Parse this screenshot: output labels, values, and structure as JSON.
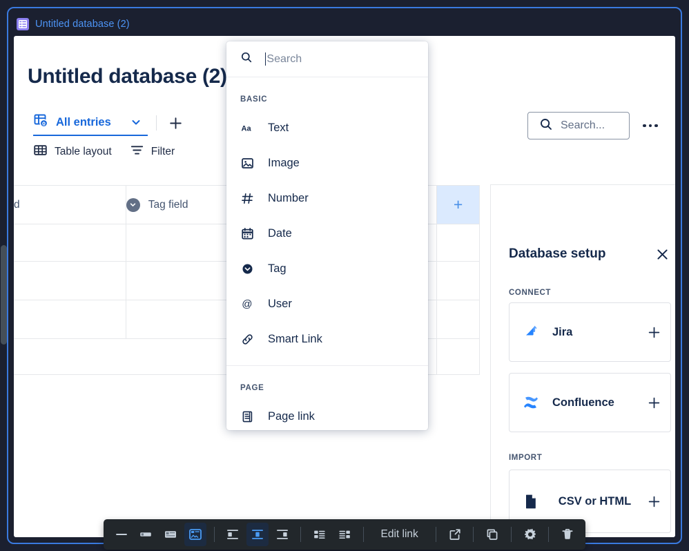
{
  "breadcrumb": {
    "icon": "database-icon",
    "label": "Untitled database (2)",
    "color": "#4d94f5"
  },
  "page": {
    "title": "Untitled database (2)"
  },
  "view_bar": {
    "view_icon": "table-home-icon",
    "view_label": "All entries",
    "chevron_icon": "chevron-down-icon",
    "add_view_icon": "plus-icon"
  },
  "toolbar": {
    "layout_icon": "table-layout-icon",
    "layout_label": "Table layout",
    "filter_icon": "filter-icon",
    "filter_label": "Filter"
  },
  "search": {
    "icon": "search-icon",
    "label": "Search...",
    "more_icon": "more-horizontal-icon"
  },
  "table": {
    "columns": [
      {
        "label": "d",
        "icon": ""
      },
      {
        "label": "Tag field",
        "icon": "tag-icon"
      },
      {
        "label": "",
        "icon": ""
      }
    ],
    "add_column_glyph": "+",
    "rows": [
      [
        "",
        "",
        ""
      ],
      [
        "",
        "",
        ""
      ],
      [
        "",
        "",
        ""
      ],
      [
        "",
        "",
        ""
      ]
    ]
  },
  "side_panel": {
    "title": "Database setup",
    "close_icon": "close-icon",
    "sections": [
      {
        "label": "CONNECT",
        "cards": [
          {
            "icon": "jira-icon",
            "label": "Jira",
            "action_icon": "plus-icon"
          },
          {
            "icon": "confluence-icon",
            "label": "Confluence",
            "action_icon": "plus-icon"
          }
        ]
      },
      {
        "label": "IMPORT",
        "cards": [
          {
            "icon": "file-icon",
            "label": "CSV or HTML",
            "action_icon": "plus-icon"
          }
        ]
      }
    ]
  },
  "field_menu": {
    "search_placeholder": "Search",
    "search_value": "",
    "groups": [
      {
        "label": "BASIC",
        "items": [
          {
            "icon": "text-icon",
            "label": "Text"
          },
          {
            "icon": "image-icon",
            "label": "Image"
          },
          {
            "icon": "number-icon",
            "label": "Number"
          },
          {
            "icon": "date-icon",
            "label": "Date"
          },
          {
            "icon": "tag-icon",
            "label": "Tag"
          },
          {
            "icon": "user-icon",
            "label": "User"
          },
          {
            "icon": "smart-link-icon",
            "label": "Smart Link"
          }
        ]
      },
      {
        "label": "PAGE",
        "items": [
          {
            "icon": "page-link-icon",
            "label": "Page link"
          }
        ]
      }
    ]
  },
  "floating_toolbar": {
    "items": [
      {
        "icon": "inline-size-icon",
        "label": "",
        "active": false
      },
      {
        "icon": "small-size-icon",
        "label": "",
        "active": false
      },
      {
        "icon": "medium-size-icon",
        "label": "",
        "active": false
      },
      {
        "icon": "full-width-icon",
        "label": "",
        "active": true
      },
      {
        "icon": "align-left-icon",
        "label": "",
        "active": false
      },
      {
        "icon": "align-center-icon",
        "label": "",
        "active": true
      },
      {
        "icon": "align-right-icon",
        "label": "",
        "active": false
      },
      {
        "icon": "wrap-left-icon",
        "label": "",
        "active": false
      },
      {
        "icon": "wrap-right-icon",
        "label": "",
        "active": false
      },
      {
        "icon": "",
        "label": "Edit link",
        "active": false
      },
      {
        "icon": "open-external-icon",
        "label": "",
        "active": false
      },
      {
        "icon": "copy-icon",
        "label": "",
        "active": false
      },
      {
        "icon": "settings-icon",
        "label": "",
        "active": false
      },
      {
        "icon": "delete-icon",
        "label": "",
        "active": false
      }
    ],
    "edit_link_label": "Edit link"
  },
  "colors": {
    "app_background": "#1b2030",
    "frame_border": "#3a7ae0",
    "accent_blue": "#1868db",
    "link_blue": "#4d94f5",
    "text_dark": "#15294b",
    "text_muted": "#44546f",
    "toolbar_bg": "#22272b",
    "highlight_cell": "#dbeafe"
  }
}
